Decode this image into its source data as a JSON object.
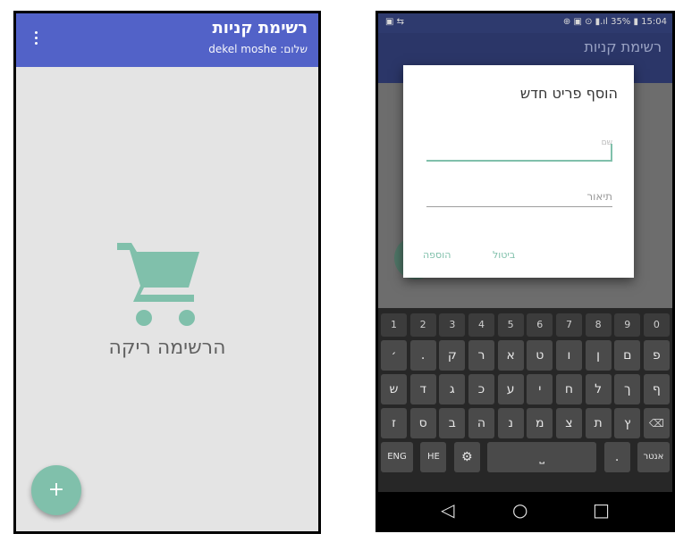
{
  "left_screen": {
    "app_title": "רשימת קניות",
    "greeting": "שלום: dekel moshe",
    "menu_icon": "overflow-menu-icon",
    "empty_icon": "shopping-cart-icon",
    "empty_text": "הרשימה ריקה",
    "fab_label": "+",
    "accent_color": "#5262c8",
    "fab_color": "#80c0ab"
  },
  "right_screen": {
    "status_left": "▣ ⇆",
    "status_right": "⊕ ▣ ⊙ ▮.ıl 35% ▮ 15:04",
    "app_title": "רשימת קניות",
    "dialog": {
      "title": "הוסף פריט חדש",
      "name_placeholder": "שם",
      "description_placeholder": "תיאור",
      "cancel_label": "ביטול",
      "add_label": "הוספה"
    },
    "keyboard": {
      "numbers": [
        "1",
        "2",
        "3",
        "4",
        "5",
        "6",
        "7",
        "8",
        "9",
        "0"
      ],
      "row1": [
        "׳",
        ".",
        "ק",
        "ר",
        "א",
        "ט",
        "ו",
        "ן",
        "ם",
        "פ"
      ],
      "row2": [
        "ש",
        "ד",
        "ג",
        "כ",
        "ע",
        "י",
        "ח",
        "ל",
        "ך",
        "ף"
      ],
      "row3": [
        "ז",
        "ס",
        "ב",
        "ה",
        "נ",
        "מ",
        "צ",
        "ת",
        "ץ"
      ],
      "backspace": "⌫",
      "lang_key": "ENG",
      "he_key": "HE",
      "settings": "⚙",
      "space": "⎵",
      "period": ".",
      "enter": "אנטר"
    },
    "nav": {
      "back": "◁",
      "home": "○",
      "recent": "□"
    }
  }
}
